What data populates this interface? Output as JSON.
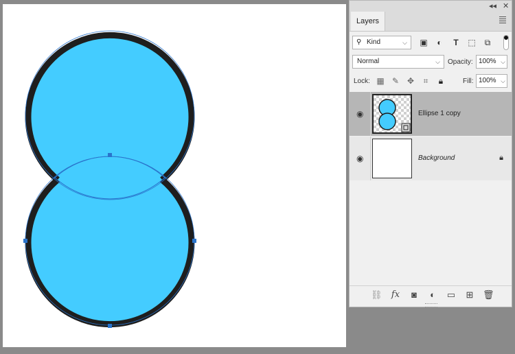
{
  "canvas": {
    "background": "#ffffff",
    "shape_fill": "#44ccff",
    "stroke": "#1e1e1e",
    "path_color": "#2a74cc"
  },
  "panel": {
    "collapse_icon": "double-chevron-left-icon",
    "close_label": "✕",
    "tab": "Layers",
    "filter": {
      "kind_label": "Kind"
    },
    "blend_mode": "Normal",
    "opacity_label": "Opacity:",
    "opacity_value": "100%",
    "lock_label": "Lock:",
    "fill_label": "Fill:",
    "fill_value": "100%",
    "layers": [
      {
        "name": "Ellipse 1 copy",
        "selected": true
      },
      {
        "name": "Background",
        "selected": false,
        "locked": true
      }
    ]
  }
}
